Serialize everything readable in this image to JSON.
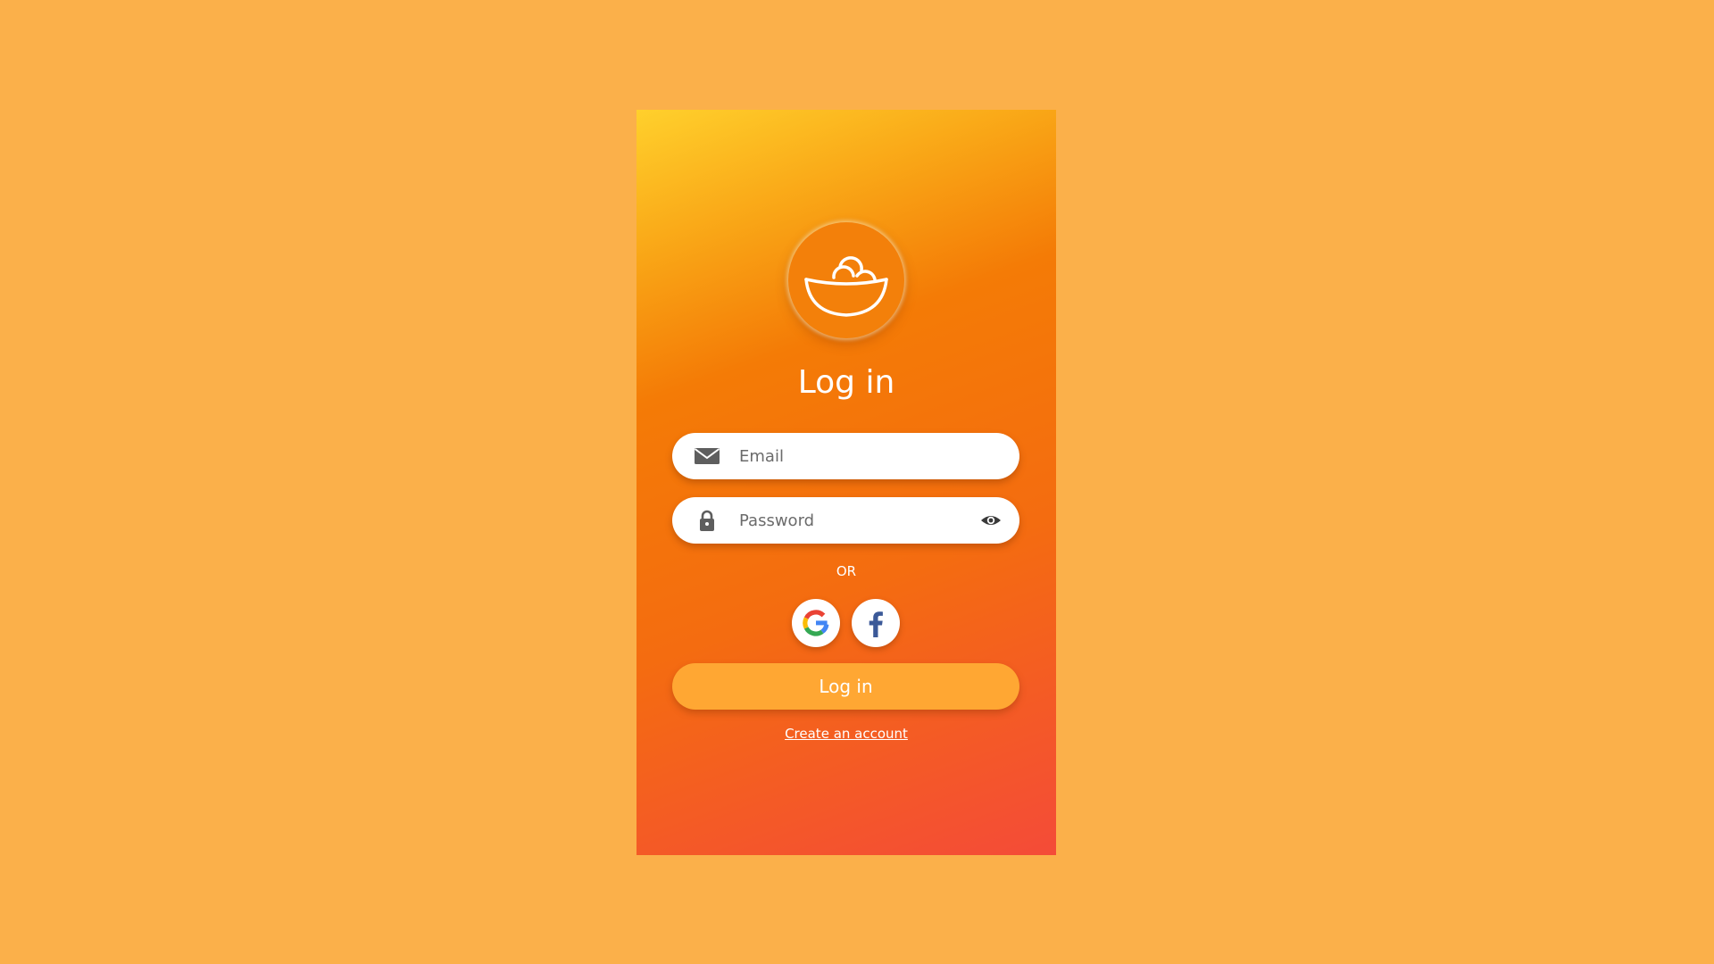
{
  "page": {
    "background": "#FBB04A"
  },
  "card": {
    "logo_icon": "bowl-with-eggs-icon",
    "title": "Log in",
    "gradient_start": "#FFD02C",
    "gradient_end": "#F44B38"
  },
  "form": {
    "email": {
      "icon": "envelope-icon",
      "placeholder": "Email",
      "value": ""
    },
    "password": {
      "icon": "lock-icon",
      "placeholder": "Password",
      "value": "",
      "toggle_icon": "eye-icon"
    },
    "divider_text": "OR",
    "social": [
      {
        "name": "Google",
        "icon": "google-icon"
      },
      {
        "name": "Facebook",
        "icon": "facebook-icon"
      }
    ],
    "submit_label": "Log in",
    "submit_color": "#FFA733",
    "create_account_label": "Create an account"
  }
}
